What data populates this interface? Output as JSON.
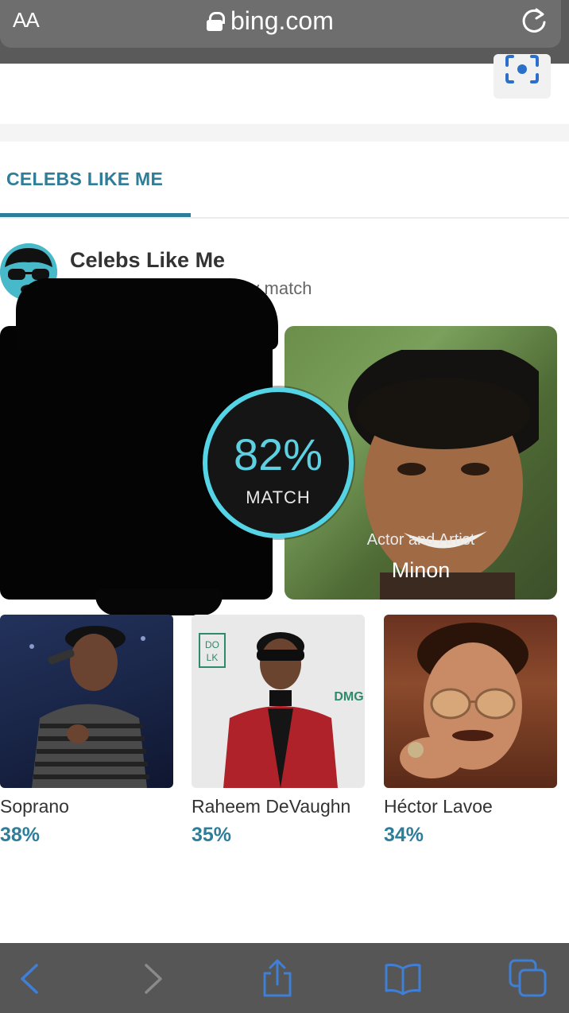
{
  "browser": {
    "text_size_label": "AA",
    "url": "bing.com"
  },
  "tab": {
    "label": "CELEBS LIKE ME"
  },
  "header": {
    "title": "Celebs Like Me",
    "subtitle": "Search for your celebrity match"
  },
  "top_match": {
    "percent": "82%",
    "label": "MATCH",
    "role": "Actor and Artist",
    "name": "Minon"
  },
  "other_matches": [
    {
      "name": "Soprano",
      "percent": "38%"
    },
    {
      "name": "Raheem DeVaughn",
      "percent": "35%"
    },
    {
      "name": "Héctor Lavoe",
      "percent": "34%"
    }
  ],
  "thumb_text": {
    "dolk_top": "DO",
    "dolk_bottom": "LK",
    "dmg": "DMG"
  },
  "colors": {
    "accent": "#2e7d99",
    "match_ring": "#55d4e6",
    "toolbar_icons": "#3f7fd6"
  },
  "icons": {
    "reload": "reload-icon",
    "visual_search": "camera-search-icon",
    "back": "back-arrow-icon",
    "forward": "forward-arrow-icon",
    "share": "share-icon",
    "bookmarks": "bookmarks-icon",
    "tabs": "tabs-icon"
  }
}
